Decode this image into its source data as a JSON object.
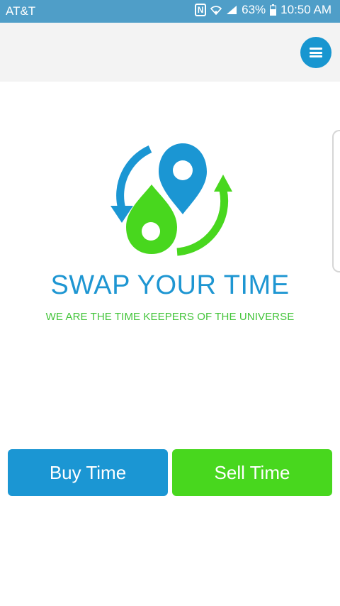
{
  "status_bar": {
    "carrier": "AT&T",
    "nfc_label": "N",
    "battery_percent": "63%",
    "time": "10:50 AM",
    "icons": [
      "nfc-icon",
      "wifi-icon",
      "signal-icon",
      "battery-icon"
    ]
  },
  "header": {
    "menu_icon": "hamburger-menu-icon"
  },
  "brand": {
    "title": "SWAP YOUR TIME",
    "tagline": "WE ARE THE TIME KEEPERS OF THE UNIVERSE",
    "logo_icon": "swap-location-pins-logo"
  },
  "actions": {
    "buy_label": "Buy Time",
    "sell_label": "Sell Time"
  },
  "colors": {
    "status_bar": "#4f9ec8",
    "header_bg": "#f3f3f3",
    "accent_blue": "#1b96d3",
    "accent_green": "#48d71e",
    "tagline_green": "#43c43a"
  }
}
